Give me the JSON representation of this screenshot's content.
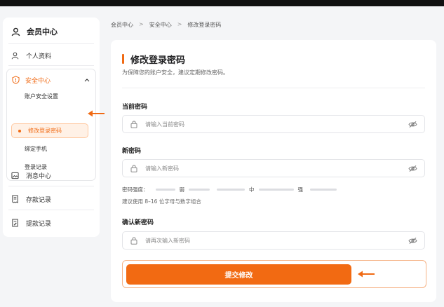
{
  "sidebar": {
    "title": "会员中心",
    "items": [
      {
        "label": "个人资料",
        "icon": "user-icon"
      },
      {
        "label": "消息中心",
        "icon": "image-icon"
      },
      {
        "label": "存款记录",
        "icon": "receipt-icon"
      },
      {
        "label": "提款记录",
        "icon": "receipt-edit-icon"
      }
    ],
    "security": {
      "label": "安全中心",
      "icon": "shield-icon",
      "expanded": true,
      "subitems": [
        {
          "label": "账户安全设置"
        },
        {
          "label": "修改登录密码",
          "active": true
        },
        {
          "label": "绑定手机"
        },
        {
          "label": "登录记录"
        }
      ]
    }
  },
  "breadcrumb": [
    "会员中心",
    "安全中心",
    "修改登录密码"
  ],
  "breadcrumb_sep": ">",
  "form": {
    "title": "修改登录密码",
    "subtitle": "为保障您的账户安全，建议定期修改密码。",
    "current": {
      "label": "当前密码",
      "placeholder": "请输入当前密码",
      "value": ""
    },
    "new": {
      "label": "新密码",
      "placeholder": "请输入新密码",
      "value": ""
    },
    "strength": {
      "label": "密码强度：",
      "levels": [
        "弱",
        "中",
        "强"
      ]
    },
    "hint": "建议使用 8–16 位字母与数字组合",
    "confirm": {
      "label": "确认新密码",
      "placeholder": "请再次输入新密码",
      "value": ""
    },
    "submit_label": "提交修改"
  },
  "colors": {
    "accent": "#f06a14",
    "accent_light": "#fff1e6",
    "page_bg": "#f4f5f7"
  }
}
